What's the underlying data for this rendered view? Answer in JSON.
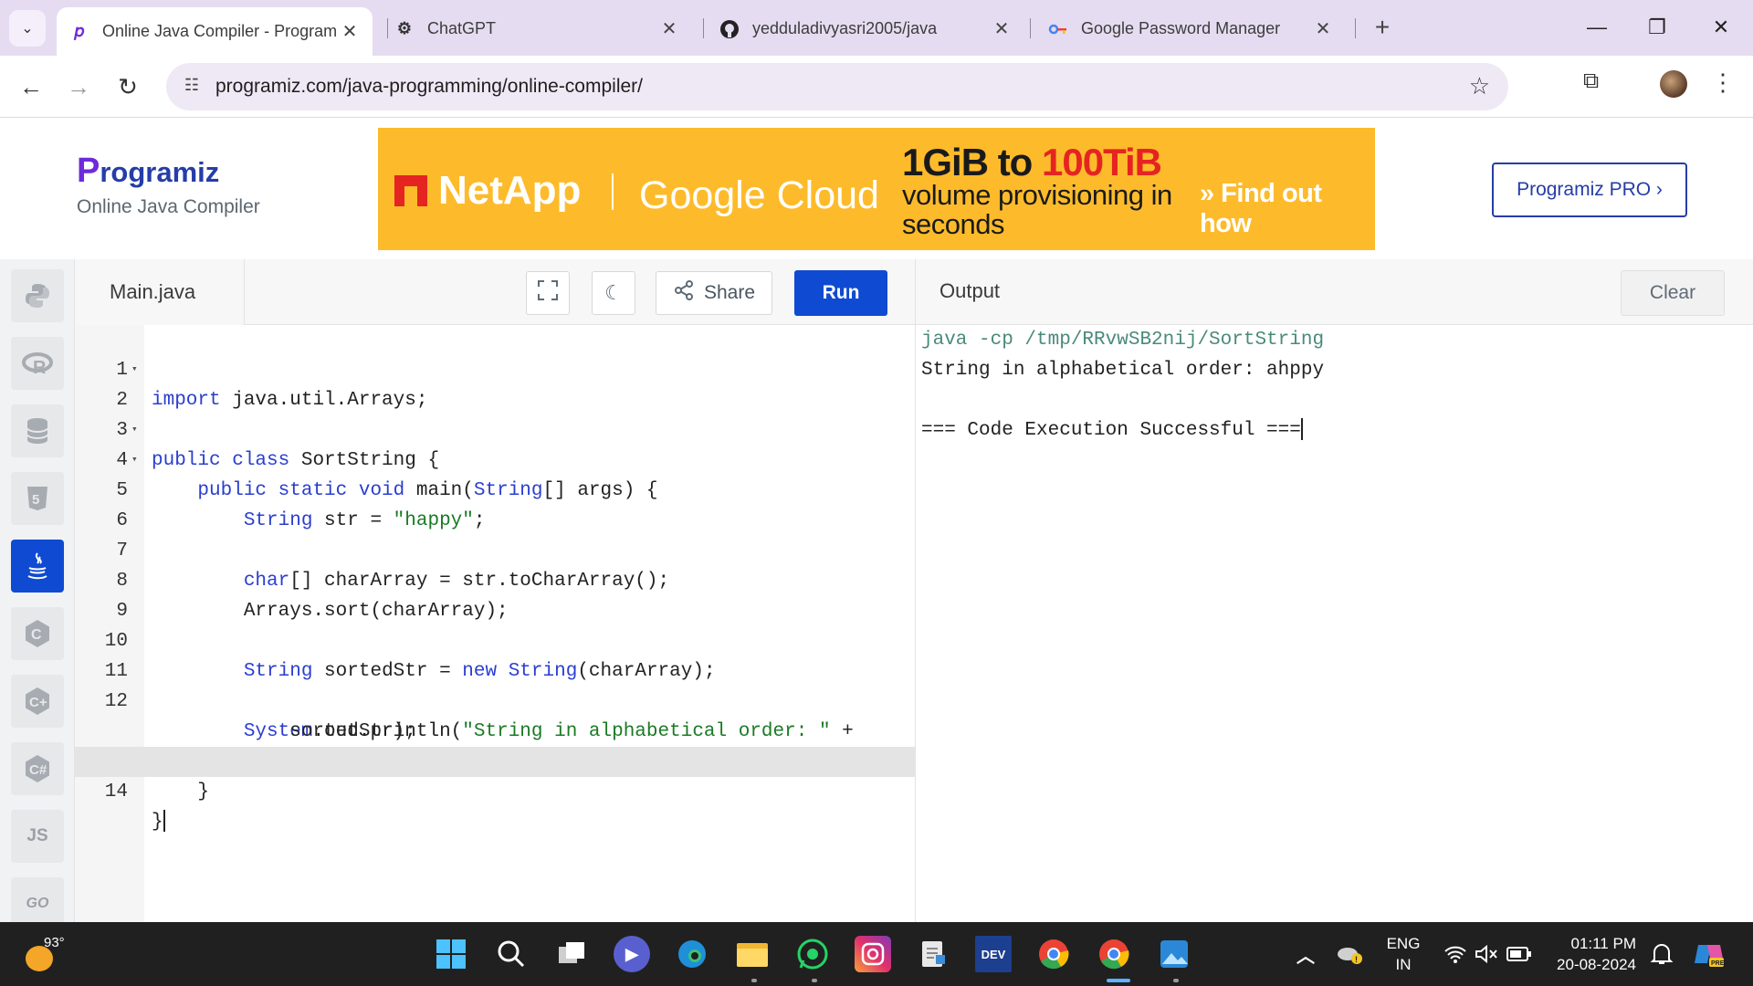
{
  "browser": {
    "tabs": [
      {
        "title": "Online Java Compiler - Program",
        "icon": "programiz-icon",
        "active": true
      },
      {
        "title": "ChatGPT",
        "icon": "chatgpt-icon",
        "active": false
      },
      {
        "title": "yedduladivyasri2005/java",
        "icon": "github-icon",
        "active": false
      },
      {
        "title": "Google Password Manager",
        "icon": "key-icon",
        "active": false
      }
    ],
    "url": "programiz.com/java-programming/online-compiler/"
  },
  "header": {
    "logo": "rogramiz",
    "logo_initial": "P",
    "subtitle": "Online Java Compiler",
    "pro_button": "Programiz PRO ›"
  },
  "ad": {
    "brand1": "NetApp",
    "brand2": "Google Cloud",
    "headline_a": "1GiB to ",
    "headline_b": "100TiB",
    "body": "volume provisioning in seconds",
    "cta": "» Find out how"
  },
  "editor": {
    "file_name": "Main.java",
    "share_label": "Share",
    "run_label": "Run"
  },
  "output": {
    "title": "Output",
    "clear_label": "Clear",
    "command": "java -cp /tmp/RRvwSB2nij/SortString",
    "result": "String in alphabetical order: ahppy",
    "status": "=== Code Execution Successful ==="
  },
  "sidebar": {
    "languages": [
      "python",
      "r",
      "sql",
      "html",
      "java",
      "c",
      "cpp",
      "csharp",
      "javascript",
      "go"
    ],
    "js_label": "JS",
    "go_label": "GO"
  },
  "taskbar": {
    "temperature": "93°",
    "lang_top": "ENG",
    "lang_bottom": "IN",
    "time": "01:11 PM",
    "date": "20-08-2024"
  },
  "colors": {
    "accent": "#0f4ad2",
    "keyword": "#2a3ecf",
    "string": "#1a7a24",
    "tab_strip": "#e6dcf1",
    "ad_background": "#fdbb2b"
  }
}
